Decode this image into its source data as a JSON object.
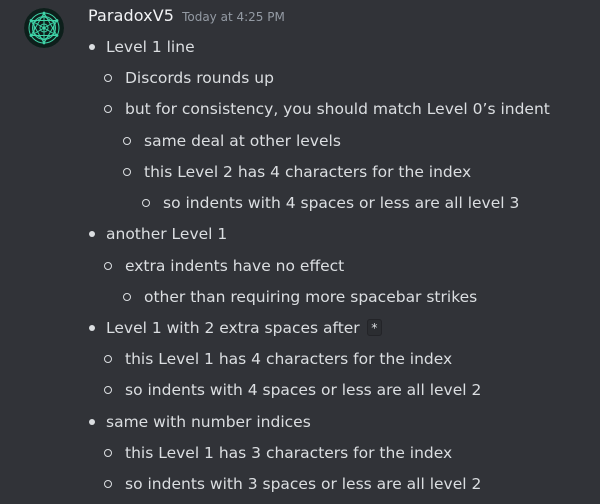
{
  "message": {
    "author": "ParadoxV5",
    "timestamp": "Today at 4:25 PM",
    "avatar_icon": "sacred-geometry-icon",
    "colors": {
      "background": "#313338",
      "avatar_bg": "#0d1f1b",
      "avatar_lines": "#3fd4a8"
    },
    "lines": [
      {
        "text": "Level 1 line"
      },
      {
        "text": "Discords rounds up"
      },
      {
        "text": "but for consistency, you should match Level 0’s indent"
      },
      {
        "text": "same deal at other levels"
      },
      {
        "text": "this Level 2 has 4 characters for the index"
      },
      {
        "text": "so indents with 4 spaces or less are all level 3"
      },
      {
        "text": "another Level 1"
      },
      {
        "text": "extra indents have no effect"
      },
      {
        "text": "other than requiring more spacebar strikes"
      },
      {
        "text": "Level 1 with 2 extra spaces after",
        "code": "*"
      },
      {
        "text": "this Level 1 has 4 characters for the index"
      },
      {
        "text": "so indents with 4 spaces or less are all level 2"
      },
      {
        "text": "same with number indices"
      },
      {
        "text": "this Level 1 has 3 characters for the index"
      },
      {
        "text": "so indents with 3 spaces or less are all level 2"
      }
    ]
  }
}
